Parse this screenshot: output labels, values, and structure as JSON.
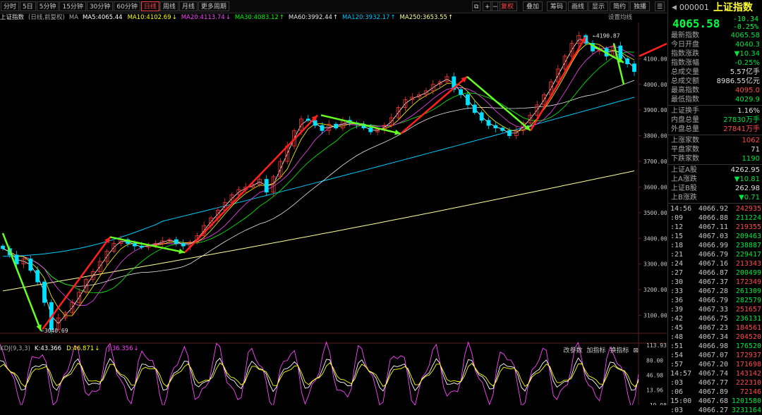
{
  "toolbar": {
    "periods": [
      "分时",
      "5日",
      "5分钟",
      "15分钟",
      "30分钟",
      "60分钟",
      "日线",
      "周线",
      "月线",
      "更多周期"
    ],
    "active_period": "日线",
    "right_buttons": [
      "复权",
      "叠加",
      "筹码",
      "画线",
      "显示",
      "简约",
      "独播"
    ],
    "active_right": "复权"
  },
  "chart": {
    "title": "上证指数",
    "subtitle": "(日线,前复权)",
    "ma_label": "MA",
    "ma_items": [
      {
        "label": "MA5:4065.44",
        "color": "#ffffff"
      },
      {
        "label": "MA10:4102.69",
        "color": "#ffff00",
        "arrow": "↓"
      },
      {
        "label": "MA20:4113.74",
        "color": "#ff44ff",
        "arrow": "↓"
      },
      {
        "label": "MA30:4083.12",
        "color": "#00ff00",
        "arrow": "↑"
      },
      {
        "label": "MA60:3992.44",
        "color": "#e8e8e8",
        "arrow": "↑"
      },
      {
        "label": "MA120:3932.17",
        "color": "#00ccff",
        "arrow": "↑"
      },
      {
        "label": "MA250:3653.55",
        "color": "#ffff99",
        "arrow": "↑"
      }
    ],
    "settings_label": "设置均线",
    "y_labels": [
      "4100.00",
      "4000.00",
      "3900.00",
      "3800.00",
      "3700.00",
      "3600.00",
      "3500.00",
      "3400.00",
      "3300.00",
      "3200.00",
      "3100.00"
    ],
    "high_label": "4190.87",
    "low_label": "3040.69",
    "kdj_title": "KDJ(9,3,3)",
    "kdj_items": [
      {
        "label": "K:43.366",
        "color": "#ffffff"
      },
      {
        "label": "D:46.871",
        "color": "#ffff00",
        "arrow": "↓"
      },
      {
        "label": "J:36.356",
        "color": "#ff44ff",
        "arrow": "↓"
      }
    ],
    "kdj_buttons": [
      "改参数",
      "加指标",
      "换指标"
    ],
    "kdj_y_labels": [
      "113.93",
      "80.00",
      "46.98",
      "13.96",
      "-19.98"
    ]
  },
  "chart_data": {
    "type": "candlestick",
    "title": "上证指数",
    "ylim": [
      3030,
      4230
    ],
    "close_points": [
      3360,
      3335,
      3300,
      3320,
      3275,
      3230,
      3150,
      3045,
      3090,
      3110,
      3150,
      3190,
      3240,
      3270,
      3310,
      3350,
      3380,
      3395,
      3380,
      3370,
      3365,
      3375,
      3380,
      3390,
      3395,
      3380,
      3370,
      3385,
      3410,
      3450,
      3480,
      3510,
      3540,
      3570,
      3590,
      3600,
      3610,
      3630,
      3580,
      3640,
      3700,
      3760,
      3820,
      3865,
      3860,
      3840,
      3820,
      3845,
      3830,
      3860,
      3850,
      3845,
      3830,
      3815,
      3825,
      3840,
      3870,
      3910,
      3940,
      3950,
      3960,
      3975,
      4000,
      4010,
      4030,
      3980,
      3960,
      3920,
      3890,
      3860,
      3840,
      3830,
      3820,
      3800,
      3820,
      3850,
      3880,
      3920,
      3960,
      4010,
      4060,
      4110,
      4160,
      4190,
      4160,
      4130,
      4140,
      4110,
      4150,
      4100,
      4080,
      4050
    ],
    "annotations": [
      {
        "type": "up",
        "from": [
          0,
          3040.69
        ],
        "to": [
          7,
          3420
        ]
      },
      {
        "type": "down",
        "from": [
          7,
          3420
        ],
        "to": [
          12,
          3335
        ]
      },
      {
        "type": "up",
        "from": [
          12,
          3335
        ],
        "to": [
          40,
          3880
        ]
      }
    ],
    "kdj": {
      "K": 43.366,
      "D": 46.871,
      "J": 36.356,
      "ylim": [
        -19.98,
        113.93
      ]
    }
  },
  "side": {
    "code": "000001",
    "name": "上证指数",
    "price": "4065.58",
    "change": "-10.34",
    "change_pct": "-0.25%",
    "stats": [
      {
        "k": "最新指数",
        "v": "4065.58",
        "c": "green"
      },
      {
        "k": "今日开盘",
        "v": "4040.3",
        "c": "green"
      },
      {
        "k": "指数涨跌",
        "v": "▼10.34",
        "c": "green"
      },
      {
        "k": "指数涨幅",
        "v": "-0.25%",
        "c": "green"
      },
      {
        "k": "总成交量",
        "v": "5.57亿手",
        "c": "white"
      },
      {
        "k": "总成交额",
        "v": "8986.55亿元",
        "c": "white"
      },
      {
        "k": "最高指数",
        "v": "4095.0",
        "c": "red"
      },
      {
        "k": "最低指数",
        "v": "4029.9",
        "c": "green"
      }
    ],
    "stats2": [
      {
        "k": "上证换手",
        "v": "1.16%",
        "c": "white"
      },
      {
        "k": "内盘总量",
        "v": "27830万手",
        "c": "green"
      },
      {
        "k": "外盘总量",
        "v": "27841万手",
        "c": "red"
      }
    ],
    "stats3": [
      {
        "k": "上涨家数",
        "v": "1062",
        "c": "red"
      },
      {
        "k": "平盘家数",
        "v": "71",
        "c": "white"
      },
      {
        "k": "下跌家数",
        "v": "1190",
        "c": "green"
      }
    ],
    "stats4": [
      {
        "k": "上证A股",
        "v": "4262.95",
        "c": "white"
      },
      {
        "k": "上A涨跌",
        "v": "▼10.81",
        "c": "green"
      },
      {
        "k": "上证B股",
        "v": "262.98",
        "c": "white"
      },
      {
        "k": "上B涨跌",
        "v": "▼0.71",
        "c": "green"
      }
    ],
    "ticks": [
      {
        "t": "14:56",
        "p": "4066.92",
        "v": "242935",
        "c": "red"
      },
      {
        "t": ":09",
        "p": "4066.88",
        "v": "211224",
        "c": "green"
      },
      {
        "t": ":12",
        "p": "4067.11",
        "v": "219355",
        "c": "red"
      },
      {
        "t": ":15",
        "p": "4067.03",
        "v": "209463",
        "c": "green"
      },
      {
        "t": ":18",
        "p": "4066.99",
        "v": "238887",
        "c": "green"
      },
      {
        "t": ":21",
        "p": "4066.79",
        "v": "229417",
        "c": "green"
      },
      {
        "t": ":24",
        "p": "4067.16",
        "v": "213343",
        "c": "red"
      },
      {
        "t": ":27",
        "p": "4066.87",
        "v": "200499",
        "c": "green"
      },
      {
        "t": ":30",
        "p": "4067.37",
        "v": "172349",
        "c": "red"
      },
      {
        "t": ":33",
        "p": "4067.28",
        "v": "261309",
        "c": "green"
      },
      {
        "t": ":36",
        "p": "4066.79",
        "v": "282579",
        "c": "green"
      },
      {
        "t": ":39",
        "p": "4067.33",
        "v": "251657",
        "c": "red"
      },
      {
        "t": ":42",
        "p": "4066.75",
        "v": "236131",
        "c": "green"
      },
      {
        "t": ":45",
        "p": "4067.23",
        "v": "184561",
        "c": "red"
      },
      {
        "t": ":48",
        "p": "4067.34",
        "v": "204520",
        "c": "red"
      },
      {
        "t": ":51",
        "p": "4066.98",
        "v": "176520",
        "c": "green"
      },
      {
        "t": ":54",
        "p": "4067.07",
        "v": "172937",
        "c": "red"
      },
      {
        "t": ":57",
        "p": "4067.20",
        "v": "171698",
        "c": "red"
      },
      {
        "t": "14:57",
        "p": "4067.74",
        "v": "143142",
        "c": "red"
      },
      {
        "t": ":03",
        "p": "4067.77",
        "v": "222310",
        "c": "red"
      },
      {
        "t": ":06",
        "p": "4067.89",
        "v": "72146",
        "c": "red"
      },
      {
        "t": "15:00",
        "p": "4067.68",
        "v": "1201580",
        "c": "green"
      },
      {
        "t": ":03",
        "p": "4066.27",
        "v": "3231164",
        "c": "green"
      }
    ]
  }
}
